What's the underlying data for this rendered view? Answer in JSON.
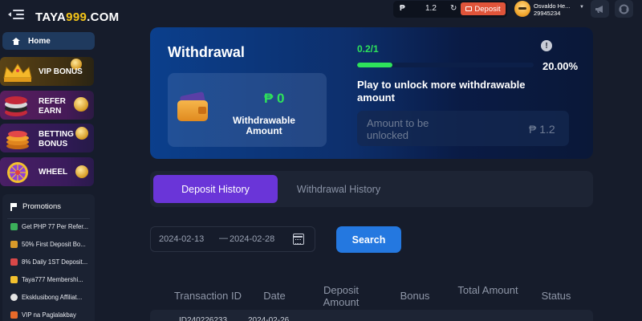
{
  "header": {
    "logo_main": "TAYA",
    "logo_accent": "999",
    "logo_suffix": ".COM",
    "currency_symbol": "₱",
    "balance": "1.2",
    "refresh_icon": "refresh-icon",
    "deposit_label": "Deposit",
    "user_name": "Osvaldo He...",
    "user_id": "29945234",
    "icons": [
      "menu-icon",
      "megaphone-icon",
      "support-icon"
    ]
  },
  "sidebar": {
    "home_label": "Home",
    "promos": [
      {
        "label": "VIP BONUS"
      },
      {
        "label": "REFER\nEARN"
      },
      {
        "label": "BETTING\nBONUS"
      },
      {
        "label": "WHEEL"
      }
    ],
    "promotions_title": "Promotions",
    "promotions": [
      {
        "label": "Get PHP 77 Per Refer..."
      },
      {
        "label": "50% First Deposit Bo..."
      },
      {
        "label": "8% Daily 1ST Deposit..."
      },
      {
        "label": "Taya777 Membershi..."
      },
      {
        "label": "Eksklusibong Affiliat..."
      },
      {
        "label": "VIP na Paglalakbay"
      }
    ]
  },
  "withdrawal": {
    "title": "Withdrawal",
    "withdrawable_amount": "₱ 0",
    "withdrawable_label": "Withdrawable Amount",
    "progress_text": "0.2/1",
    "progress_percent": "20.00%",
    "progress_fraction": 0.2,
    "info_icon": "!",
    "unlock_message": "Play to unlock more withdrawable amount",
    "locked_label": "Amount to be unlocked",
    "locked_amount": "₱ 1.2"
  },
  "tabs": {
    "deposit_history": "Deposit History",
    "withdrawal_history": "Withdrawal History"
  },
  "filter": {
    "start_date": "2024-02-13",
    "separator": "—",
    "end_date": "2024-02-28",
    "search_label": "Search"
  },
  "table": {
    "headers": [
      "Transaction ID",
      "Date",
      "Deposit Amount",
      "Bonus",
      "Total Amount",
      "Status"
    ],
    "first_row_partial": {
      "id": "ID240226233...",
      "date": "2024-02-26"
    }
  },
  "colors": {
    "accent_purple": "#6a35d8",
    "search_blue": "#2478e0",
    "progress_green": "#2ee35b",
    "deposit_orange": "#e0543a"
  }
}
